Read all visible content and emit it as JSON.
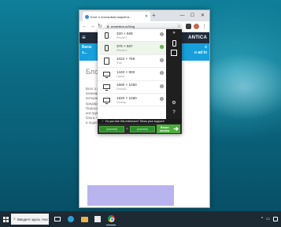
{
  "browser": {
    "tab_title": "Блог о поисковом маркети...",
    "url": "seoantica.ru/blog"
  },
  "site": {
    "logo": "ANTICA",
    "banner_left_1": "Беси",
    "banner_left_2": "з...",
    "banner_right_1": "с",
    "banner_right_2": "o ad in",
    "blog_title": "Блог",
    "article_lines": [
      "Блог о поисковом маркетинге",
      "начинающих и опытных",
      "интернет-маркетологов, копирайтеров, а также",
      "предпринимателей и специалистов в сфере digital.",
      "Поисковый маркетинг — это множество тонкостей,",
      "инструментов, секретов и фишек. Задача нашего",
      "блога — адекватно и понятно рассказать вам обо всем",
      "и поделиться нашим опытом."
    ]
  },
  "extension": {
    "resolutions": [
      {
        "size": "320 × 568",
        "label": "iPhone 5",
        "device": "phone",
        "active": false
      },
      {
        "size": "375 × 667",
        "label": "iPhone 6",
        "device": "phone",
        "active": true
      },
      {
        "size": "1024 × 768",
        "label": "iPad",
        "device": "tablet",
        "active": false
      },
      {
        "size": "1440 × 900",
        "label": "Laptop",
        "device": "monitor",
        "active": false
      },
      {
        "size": "1680 × 1050",
        "label": "Desktop",
        "device": "monitor",
        "active": false
      },
      {
        "size": "1920 × 1080",
        "label": "Desktop",
        "device": "monitor",
        "active": false
      }
    ],
    "support_text": "Do you like this extension? Show your support!",
    "width_field": "(current)",
    "height_field": "(current)",
    "times": "×",
    "resize_label_1": "Resize",
    "resize_label_2": "window"
  },
  "taskbar": {
    "search_placeholder": "Введите здесь текст для поиска"
  }
}
